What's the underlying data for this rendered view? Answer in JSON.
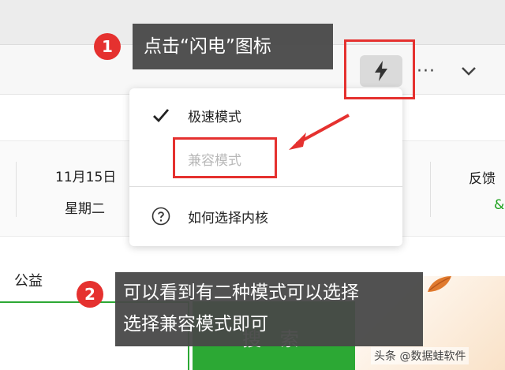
{
  "browser": {
    "more_label": "···"
  },
  "dropdown": {
    "items": [
      {
        "label": "极速模式",
        "checked": true,
        "enabled": true
      },
      {
        "label": "兼容模式",
        "checked": false,
        "enabled": false
      },
      {
        "label": "如何选择内核",
        "icon": "help-icon"
      }
    ]
  },
  "page": {
    "date": "11月15日",
    "weekday": "星期二",
    "feedback": "反馈",
    "gongyi": "公益",
    "search_button": "搜 索",
    "green_glyph": "&"
  },
  "annotations": {
    "step1": {
      "number": "1",
      "text": "点击“闪电”图标"
    },
    "step2": {
      "number": "2",
      "line1": "可以看到有二种模式可以选择",
      "line2": "选择兼容模式即可"
    }
  },
  "watermark": "头条 @数据蛙软件",
  "colors": {
    "accent_red": "#e5312f",
    "search_green": "#2ca834",
    "callout_bg": "#484848"
  }
}
